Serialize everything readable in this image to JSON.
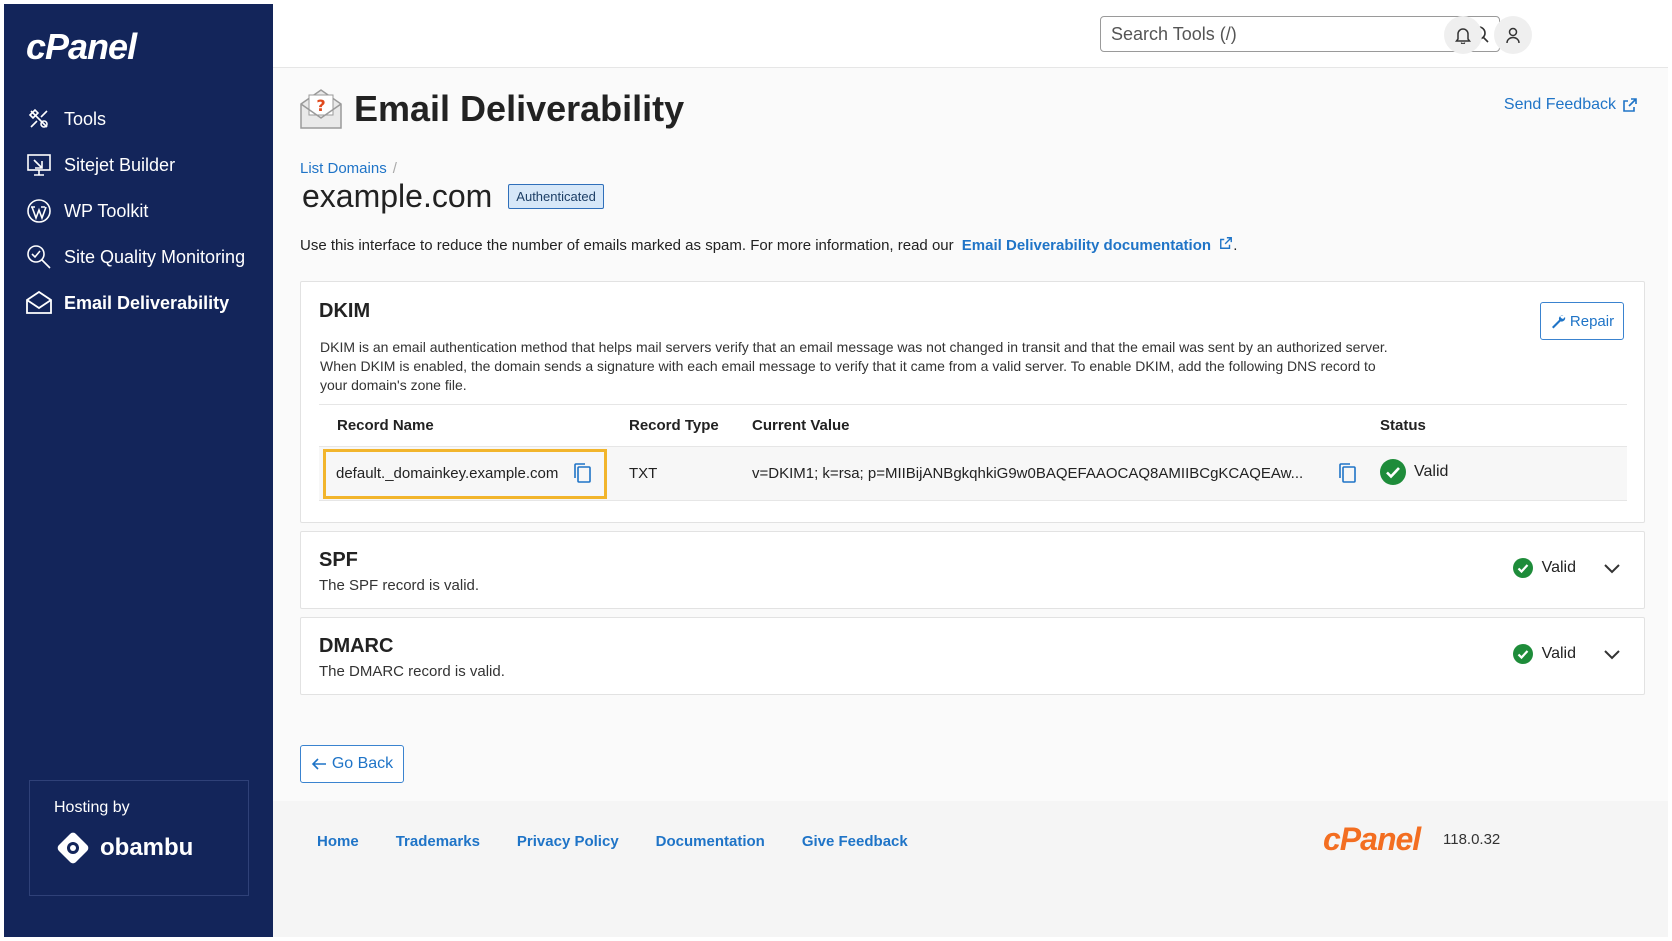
{
  "sidebar": {
    "logo": "cPanel",
    "items": [
      {
        "label": "Tools",
        "icon": "tools-icon"
      },
      {
        "label": "Sitejet Builder",
        "icon": "sitejet-icon"
      },
      {
        "label": "WP Toolkit",
        "icon": "wordpress-icon"
      },
      {
        "label": "Site Quality Monitoring",
        "icon": "magnifier-icon"
      },
      {
        "label": "Email Deliverability",
        "icon": "envelope-icon"
      }
    ],
    "hosting_label": "Hosting by",
    "hosting_brand": "obambu"
  },
  "header": {
    "search_placeholder": "Search Tools (/)"
  },
  "page": {
    "title": "Email Deliverability",
    "send_feedback": "Send Feedback",
    "breadcrumb": "List Domains",
    "breadcrumb_sep": "/",
    "domain": "example.com",
    "badge": "Authenticated",
    "intro_text": "Use this interface to reduce the number of emails marked as spam. For more information, read our",
    "intro_link": "Email Deliverability documentation",
    "intro_end": "."
  },
  "dkim": {
    "title": "DKIM",
    "repair_label": "Repair",
    "description": "DKIM is an email authentication method that helps mail servers verify that an email message was not changed in transit and that the email was sent by an authorized server. When DKIM is enabled, the domain sends a signature with each email message to verify that it came from a valid server. To enable DKIM, add the following DNS record to your domain's zone file.",
    "columns": [
      "Record Name",
      "Record Type",
      "Current Value",
      "Status"
    ],
    "row": {
      "record_name": "default._domainkey.example.com",
      "record_type": "TXT",
      "current_value": "v=DKIM1; k=rsa; p=MIIBijANBgkqhkiG9w0BAQEFAAOCAQ8AMIIBCgKCAQEAw...",
      "status": "Valid"
    }
  },
  "spf": {
    "title": "SPF",
    "description": "The SPF record is valid.",
    "status": "Valid"
  },
  "dmarc": {
    "title": "DMARC",
    "description": "The DMARC record is valid.",
    "status": "Valid"
  },
  "go_back": "Go Back",
  "footer": {
    "links": [
      "Home",
      "Trademarks",
      "Privacy Policy",
      "Documentation",
      "Give Feedback"
    ],
    "logo": "cPanel",
    "version": "118.0.32"
  },
  "colors": {
    "sidebar_bg": "#13255a",
    "link": "#1f74c7",
    "valid_green": "#1e8c3a",
    "highlight": "#f2b52c",
    "footer_logo": "#f36e21"
  }
}
